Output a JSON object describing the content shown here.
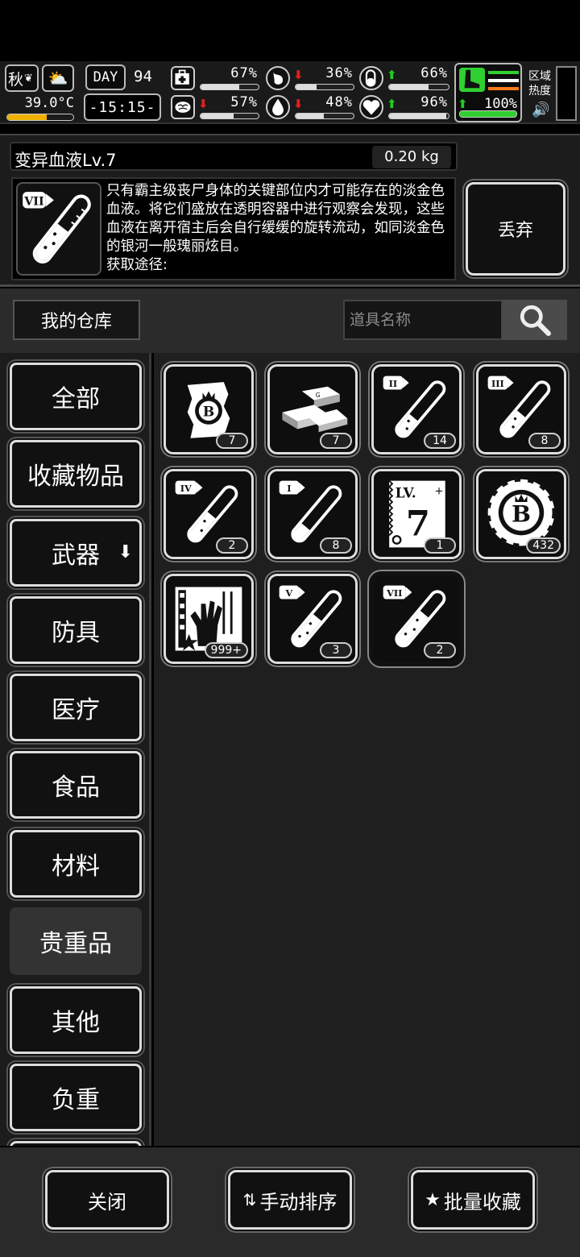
{
  "status": {
    "season": "秋",
    "day_label": "DAY",
    "day_value": "94",
    "temperature": "39.0°C",
    "time": "-15:15-",
    "region_heat_label": "区域\n热度",
    "stats": [
      {
        "id": "health",
        "icon": "medkit-icon",
        "arrow": "",
        "value": "67%",
        "fill": 0.67
      },
      {
        "id": "hunger",
        "icon": "stomach-icon",
        "arrow": "down",
        "value": "36%",
        "fill": 0.36
      },
      {
        "id": "medicine",
        "icon": "pill-icon",
        "arrow": "up",
        "value": "66%",
        "fill": 0.66
      },
      {
        "id": "sanity",
        "icon": "brain-icon",
        "arrow": "down",
        "value": "57%",
        "fill": 0.57
      },
      {
        "id": "thirst",
        "icon": "water-drop-icon",
        "arrow": "down",
        "value": "48%",
        "fill": 0.48
      },
      {
        "id": "mood",
        "icon": "heart-icon",
        "arrow": "up",
        "value": "96%",
        "fill": 0.96
      },
      {
        "id": "stamina",
        "icon": "boot-icon",
        "arrow": "up",
        "value": "100%",
        "fill": 1.0
      }
    ],
    "colors": {
      "up": "#22cc22",
      "down": "#e02020",
      "stamina": "#2fd02f"
    }
  },
  "detail": {
    "title": "变异血液Lv.7",
    "weight": "0.20 kg",
    "level_roman": "VII",
    "description": "只有霸主级丧尸身体的关键部位内才可能存在的淡金色血液。将它们盛放在透明容器中进行观察会发现，这些血液在离开宿主后会自行缓缓的旋转流动，如同淡金色的银河一般瑰丽炫目。",
    "obtain_label": "获取途径:",
    "discard_label": "丢弃"
  },
  "warehouse": {
    "label": "我的仓库",
    "search_placeholder": "道具名称"
  },
  "categories": [
    {
      "label": "全部",
      "active": false
    },
    {
      "label": "收藏物品",
      "active": false
    },
    {
      "label": "武器",
      "active": false,
      "dropdown": true
    },
    {
      "label": "防具",
      "active": false
    },
    {
      "label": "医疗",
      "active": false
    },
    {
      "label": "食品",
      "active": false
    },
    {
      "label": "材料",
      "active": false
    },
    {
      "label": "贵重品",
      "active": true
    },
    {
      "label": "其他",
      "active": false
    },
    {
      "label": "负重",
      "active": false
    }
  ],
  "items": [
    {
      "icon": "coin-pouch-icon",
      "count": "7"
    },
    {
      "icon": "gold-bars-icon",
      "count": "7"
    },
    {
      "icon": "blood-vial-icon",
      "roman": "II",
      "count": "14"
    },
    {
      "icon": "blood-vial-icon",
      "roman": "III",
      "count": "8"
    },
    {
      "icon": "blood-vial-icon",
      "roman": "IV",
      "count": "2"
    },
    {
      "icon": "blood-vial-icon",
      "roman": "I",
      "count": "8"
    },
    {
      "icon": "level-ticket-icon",
      "level_label": "LV.",
      "level_value": "7",
      "count": "1"
    },
    {
      "icon": "casino-chip-icon",
      "count": "432"
    },
    {
      "icon": "zombie-card-icon",
      "count": "999+"
    },
    {
      "icon": "blood-vial-icon",
      "roman": "V",
      "count": "3"
    },
    {
      "icon": "blood-vial-icon",
      "roman": "VII",
      "count": "2",
      "selected": true
    }
  ],
  "bottom": {
    "close_label": "关闭",
    "sort_label": "手动排序",
    "batch_label": "批量收藏"
  }
}
